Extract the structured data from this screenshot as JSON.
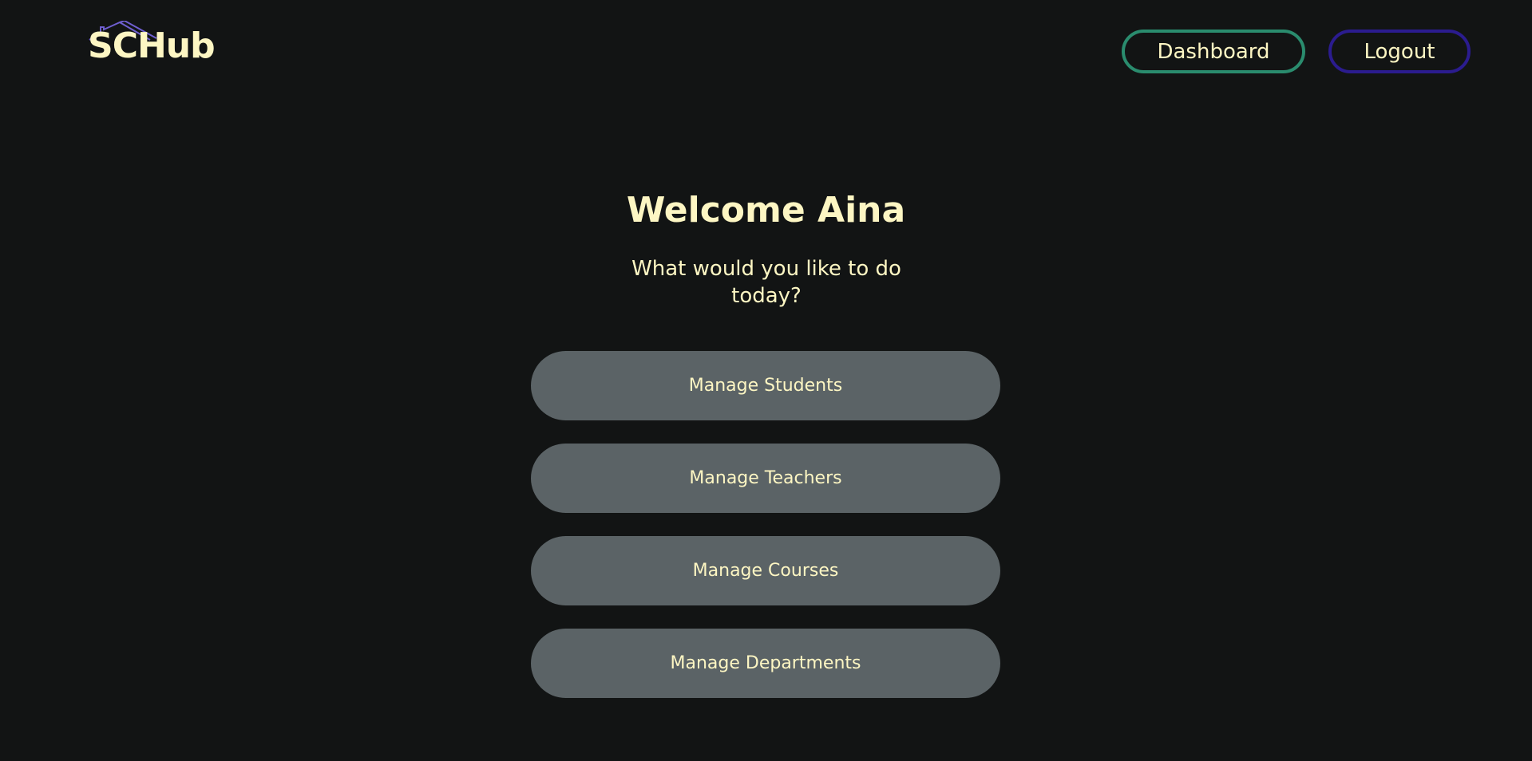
{
  "header": {
    "logo_text": "SCHub",
    "logo_icon": "house-roof-icon",
    "nav": {
      "dashboard_label": "Dashboard",
      "logout_label": "Logout"
    }
  },
  "main": {
    "welcome_title": "Welcome Aina",
    "subtitle": "What would you like to do today?",
    "actions": [
      {
        "label": "Manage Students"
      },
      {
        "label": "Manage Teachers"
      },
      {
        "label": "Manage Courses"
      },
      {
        "label": "Manage Departments"
      }
    ]
  },
  "colors": {
    "background": "#121414",
    "text": "#fdf6c3",
    "dashboard_border": "#2a8c6e",
    "logout_border": "#2b1c8f",
    "action_button_bg": "#5b6366",
    "logo_roof": "#6f5fd0"
  }
}
